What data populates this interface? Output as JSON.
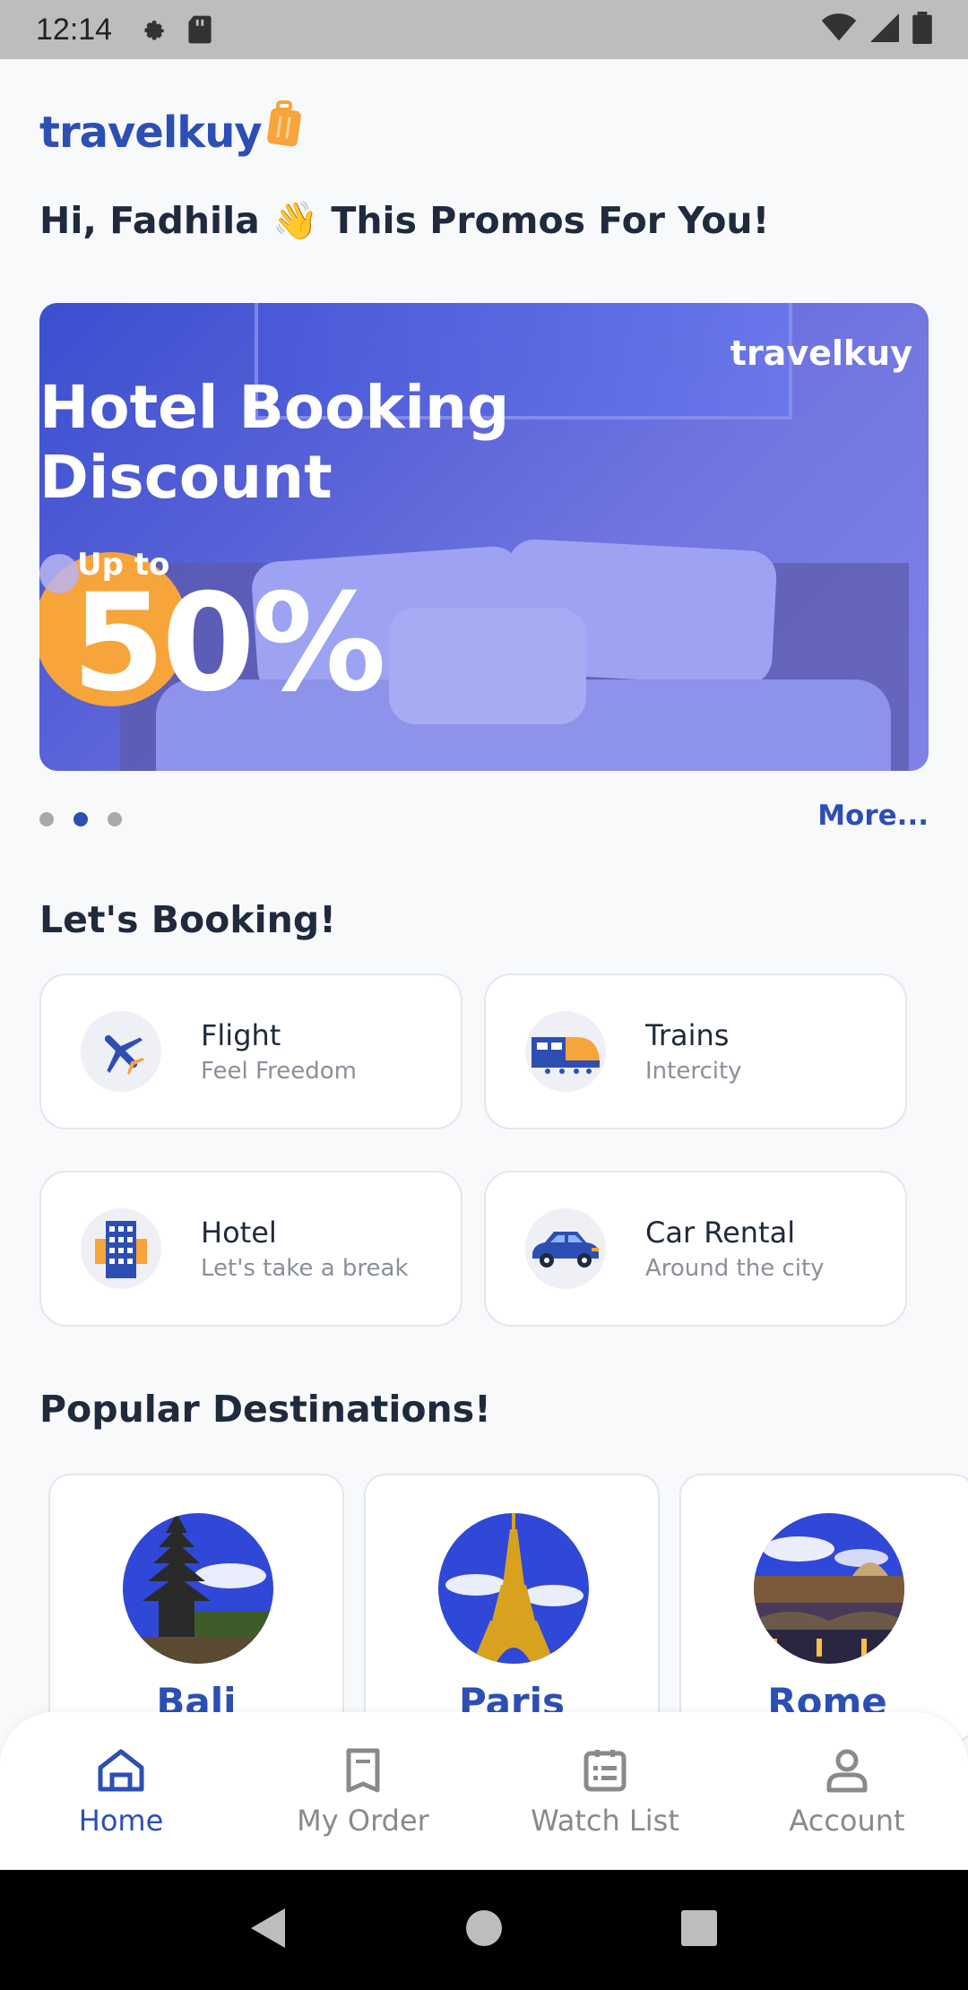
{
  "status_bar": {
    "time": "12:14"
  },
  "app": {
    "logo_text": "travelkuy"
  },
  "greeting": "Hi, Fadhila 👋 This Promos For You!",
  "banner": {
    "logo_text": "travelkuy",
    "title_line1": "Hotel Booking",
    "title_line2": "Discount",
    "upto": "Up to",
    "discount": "50%"
  },
  "carousel": {
    "count": 3,
    "active_index": 1,
    "more_label": "More..."
  },
  "booking": {
    "title": "Let's Booking!",
    "items": [
      {
        "title": "Flight",
        "subtitle": "Feel Freedom",
        "icon": "airplane-icon"
      },
      {
        "title": "Trains",
        "subtitle": "Intercity",
        "icon": "train-icon"
      },
      {
        "title": "Hotel",
        "subtitle": "Let's take a break",
        "icon": "hotel-icon"
      },
      {
        "title": "Car Rental",
        "subtitle": "Around the city",
        "icon": "car-icon"
      }
    ]
  },
  "destinations": {
    "title": "Popular Destinations!",
    "items": [
      {
        "name": "Bali"
      },
      {
        "name": "Paris"
      },
      {
        "name": "Rome"
      }
    ]
  },
  "bottom_nav": {
    "items": [
      {
        "label": "Home",
        "icon": "home-icon",
        "active": true
      },
      {
        "label": "My Order",
        "icon": "receipt-icon",
        "active": false
      },
      {
        "label": "Watch List",
        "icon": "list-icon",
        "active": false
      },
      {
        "label": "Account",
        "icon": "user-icon",
        "active": false
      }
    ]
  },
  "colors": {
    "brand": "#2d4fb4",
    "accent": "#f7a43a",
    "inactive": "#8a8a8a"
  }
}
